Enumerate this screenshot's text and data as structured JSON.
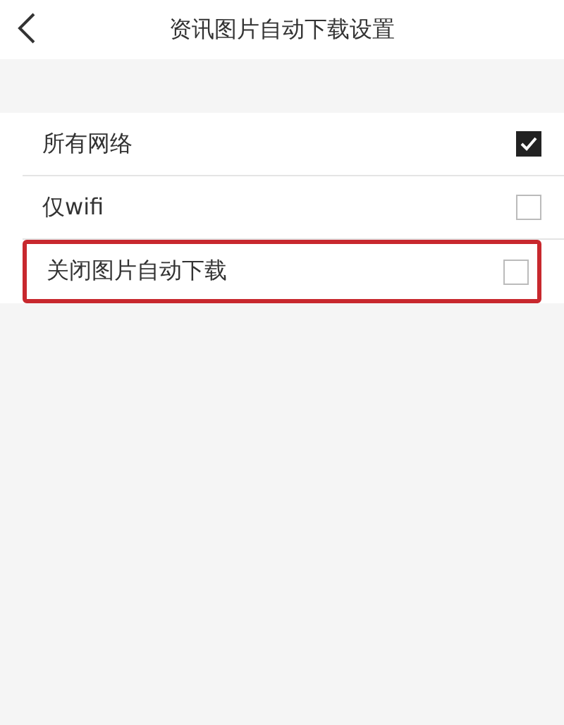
{
  "header": {
    "title": "资讯图片自动下载设置"
  },
  "options": [
    {
      "label": "所有网络",
      "checked": true,
      "highlighted": false
    },
    {
      "label": "仅wifi",
      "checked": false,
      "highlighted": false
    },
    {
      "label": "关闭图片自动下载",
      "checked": false,
      "highlighted": true
    }
  ]
}
